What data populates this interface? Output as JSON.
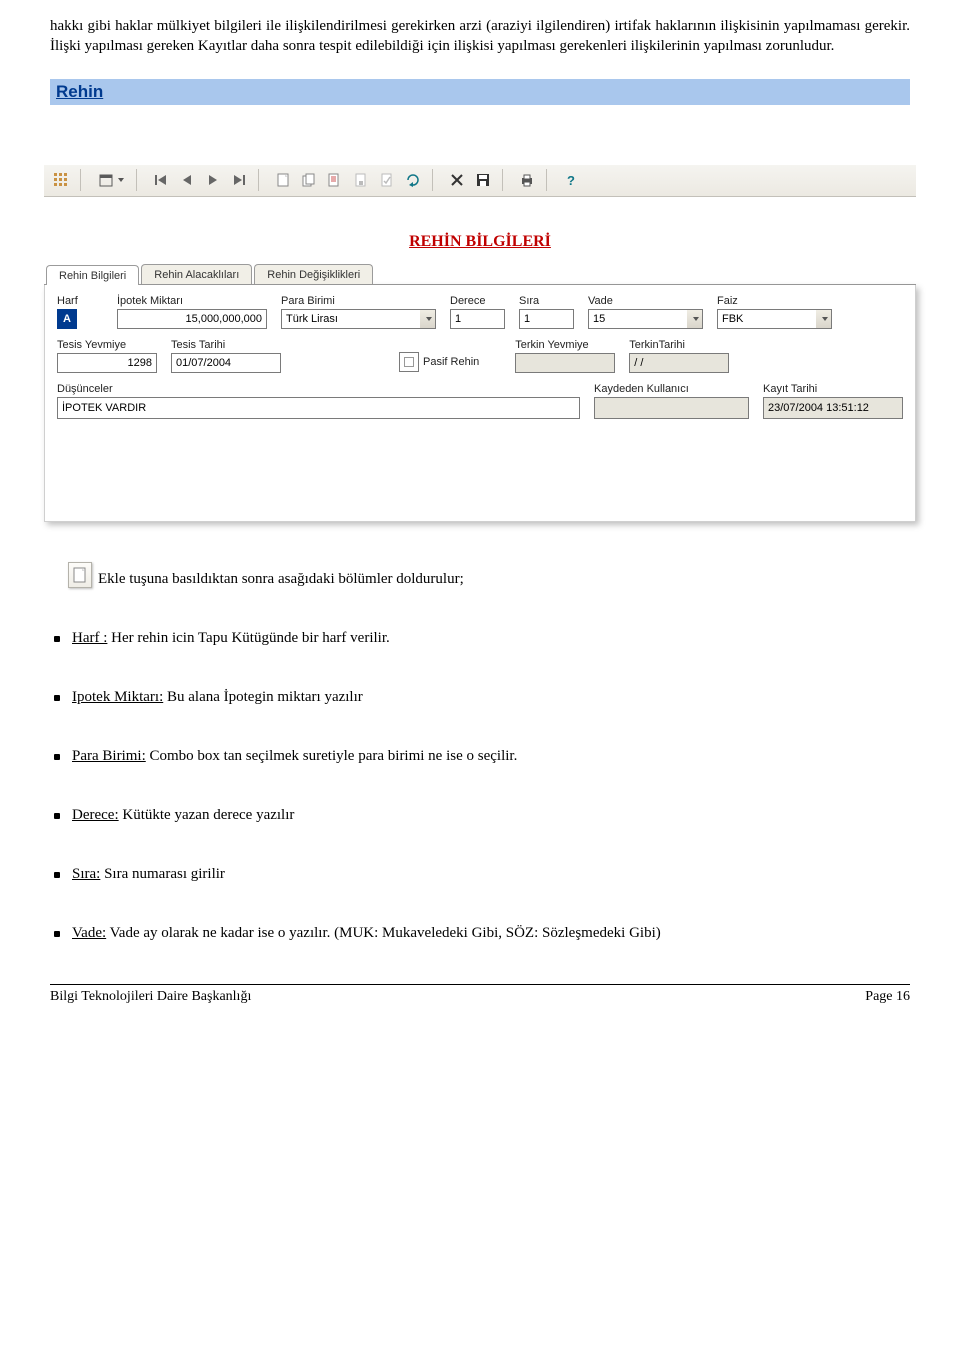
{
  "para1": "hakkı gibi haklar mülkiyet bilgileri ile ilişkilendirilmesi gerekirken arzi (araziyi ilgilendiren) irtifak haklarının ilişkisinin yapılmaması gerekir. İlişki yapılması gereken Kayıtlar daha sonra tespit edilebildiği için ilişkisi yapılması gerekenleri ilişkilerinin yapılması zorunludur.",
  "section_link": "Rehin",
  "form_heading": "REHİN BİLGİLERİ",
  "tabs": {
    "t0": "Rehin Bilgileri",
    "t1": "Rehin Alacaklıları",
    "t2": "Rehin Değişiklikleri"
  },
  "labels": {
    "harf": "Harf",
    "ipotek_miktari": "İpotek Miktarı",
    "para_birimi": "Para Birimi",
    "derece": "Derece",
    "sira": "Sıra",
    "vade": "Vade",
    "faiz": "Faiz",
    "tesis_yevmiye": "Tesis Yevmiye",
    "tesis_tarihi": "Tesis Tarihi",
    "pasif_rehin": "Pasif Rehin",
    "terkin_yevmiye": "Terkin Yevmiye",
    "terkin_tarihi": "TerkinTarihi",
    "dusunceler": "Düşünceler",
    "kaydeden": "Kaydeden Kullanıcı",
    "kayit_tarihi": "Kayıt Tarihi"
  },
  "values": {
    "harf": "A",
    "ipotek_miktari": "15,000,000,000",
    "para_birimi": "Türk Lirası",
    "derece": "1",
    "sira": "1",
    "vade": "15",
    "faiz": "FBK",
    "tesis_yevmiye": "1298",
    "tesis_tarihi": "01/07/2004",
    "terkin_yevmiye": "",
    "terkin_tarihi": "  /  /",
    "dusunceler": "İPOTEK VARDIR",
    "kaydeden": "",
    "kayit_tarihi": "23/07/2004 13:51:12"
  },
  "ekle_caption": "Ekle tuşuna basıldıktan sonra asağıdaki bölümler doldurulur;",
  "bullets": {
    "b1_label": "Harf :",
    "b1_rest": " Her rehin icin Tapu Kütügünde bir harf verilir.",
    "b2_label": "Ipotek Miktarı:",
    "b2_rest": " Bu alana İpotegin miktarı yazılır",
    "b3_label": "Para Birimi:",
    "b3_rest": " Combo box tan seçilmek suretiyle para birimi ne ise o seçilir.",
    "b4_label": "Derece:",
    "b4_rest": " Kütükte yazan derece yazılır",
    "b5_label": "Sıra:",
    "b5_rest": " Sıra numarası girilir",
    "b6_label": "Vade:",
    "b6_rest": " Vade ay olarak ne kadar ise o yazılır. (MUK: Mukaveledeki Gibi, SÖZ: Sözleşmedeki Gibi)"
  },
  "footer_left": "Bilgi Teknolojileri Daire Başkanlığı",
  "footer_right": "Page 16"
}
